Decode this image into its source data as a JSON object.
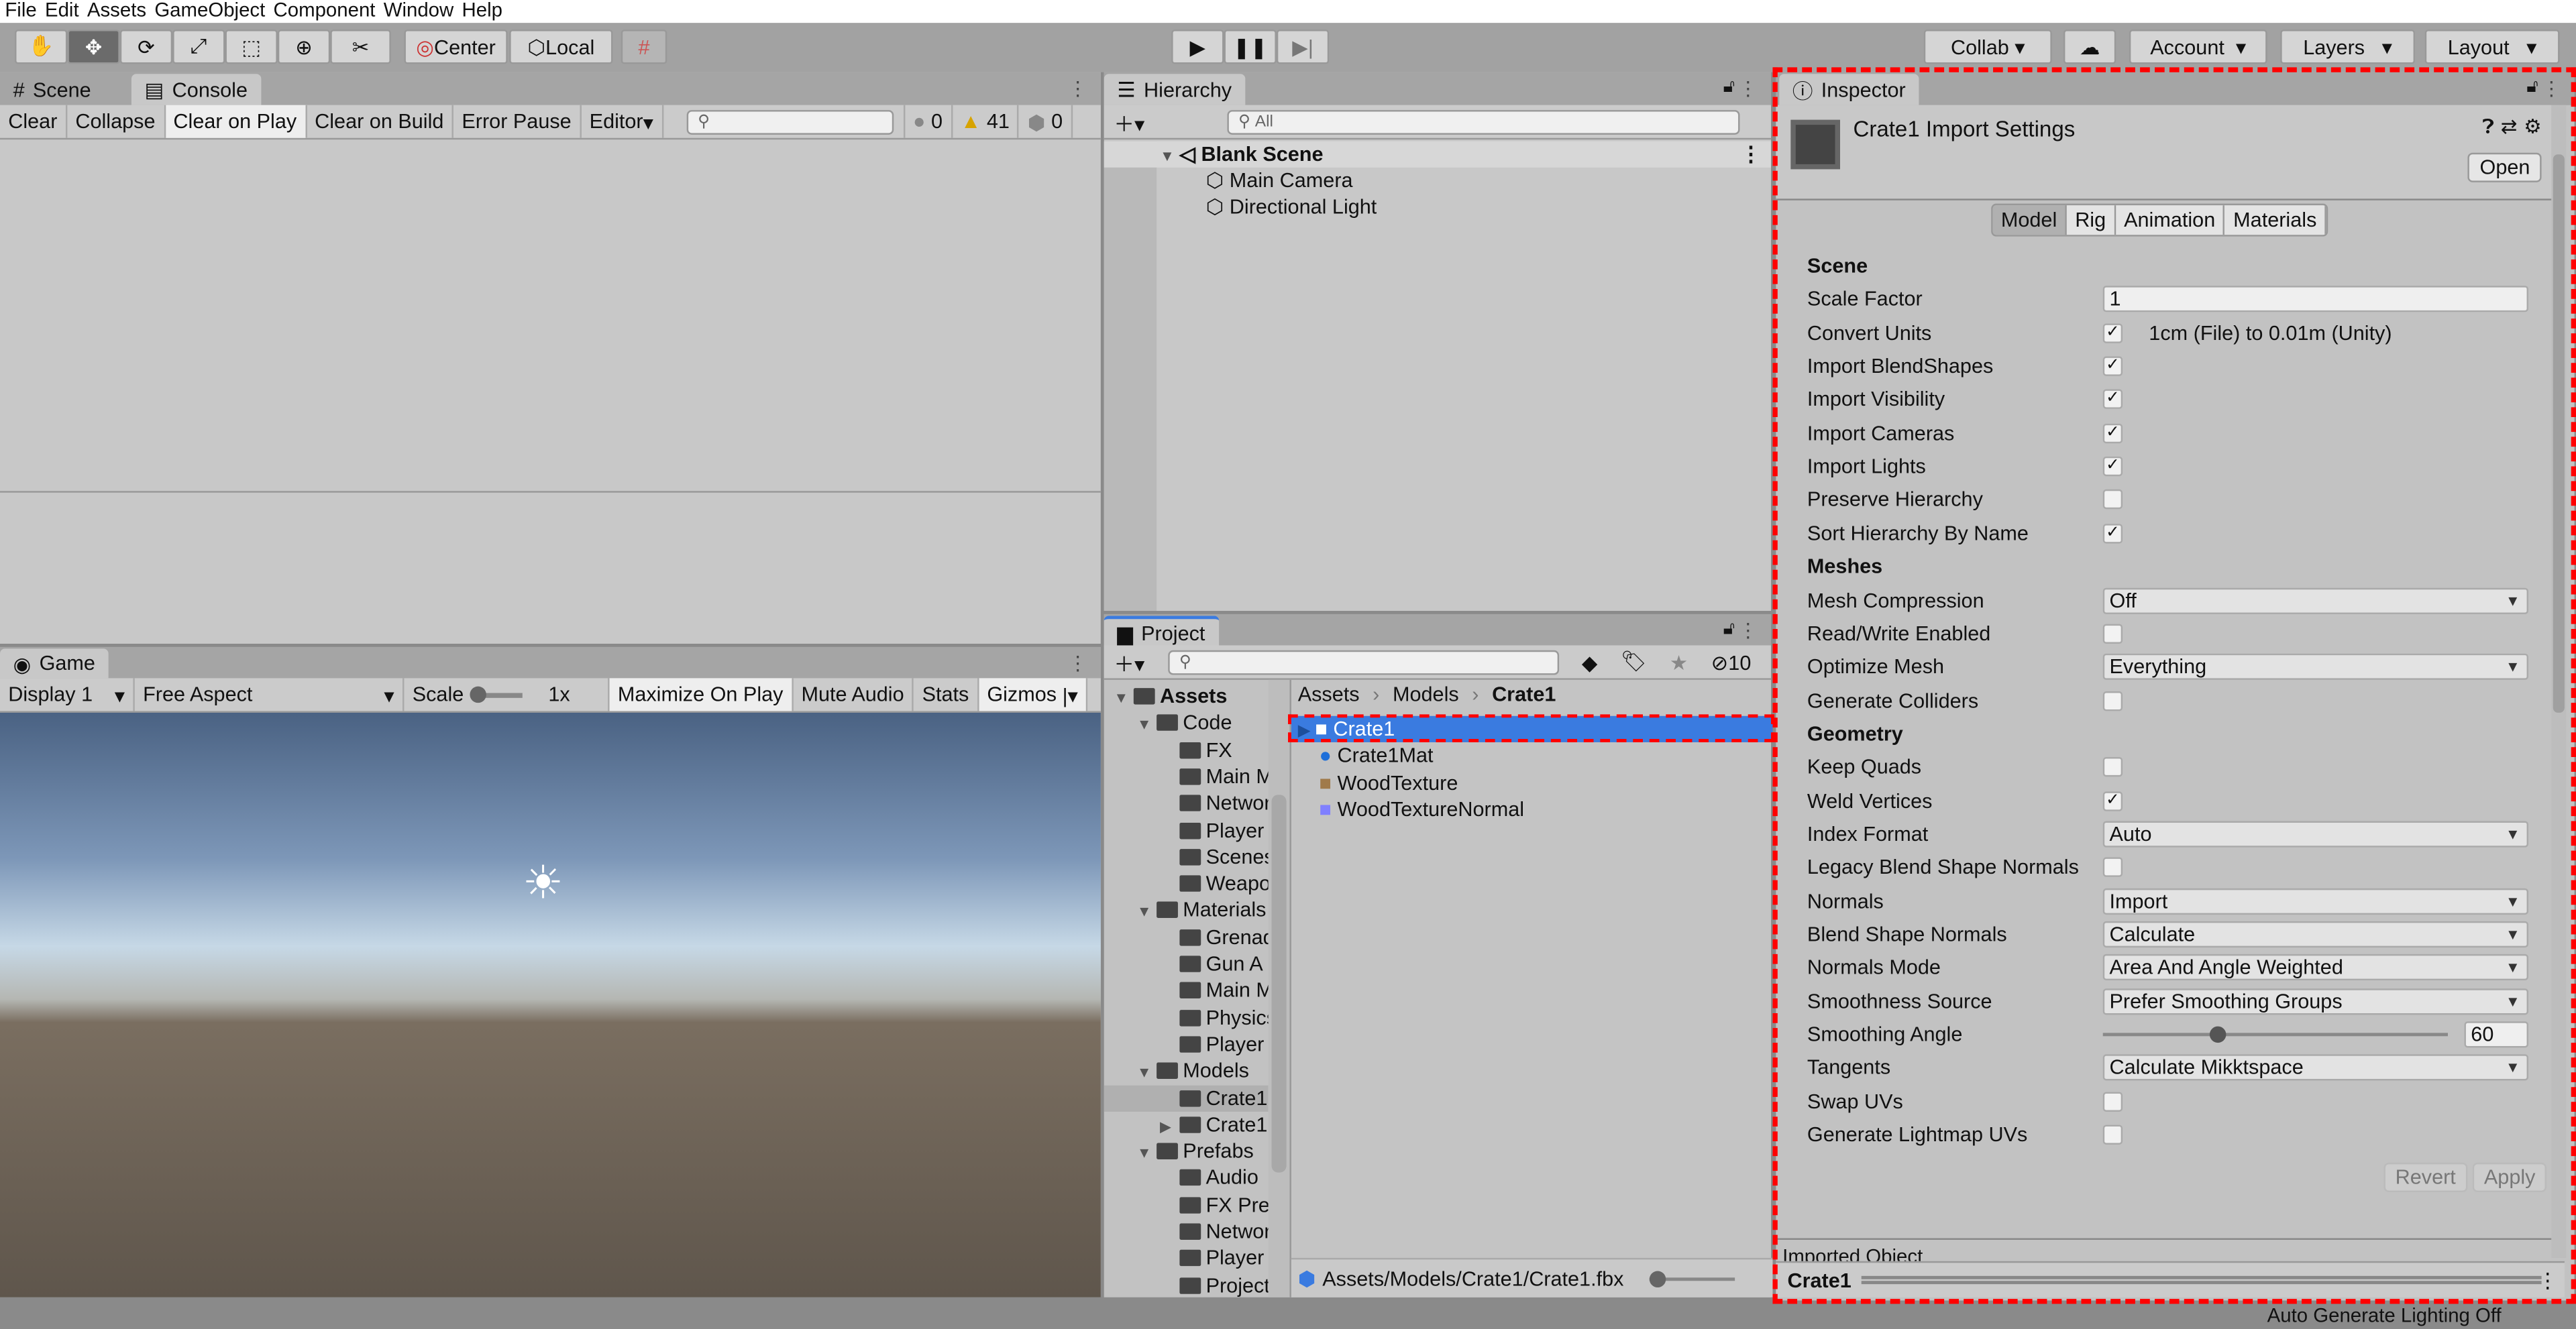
{
  "menu": [
    "File",
    "Edit",
    "Assets",
    "GameObject",
    "Component",
    "Window",
    "Help"
  ],
  "toolbar": {
    "pivot": "Center",
    "space": "Local",
    "collab": "Collab",
    "account": "Account",
    "layers": "Layers",
    "layout": "Layout"
  },
  "console": {
    "tabs": [
      "Scene",
      "Console"
    ],
    "buttons": [
      "Clear",
      "Collapse",
      "Clear on Play",
      "Clear on Build",
      "Error Pause",
      "Editor"
    ],
    "counts": {
      "errors_info": "0",
      "warnings": "41",
      "errors": "0"
    }
  },
  "game": {
    "tab": "Game",
    "display": "Display 1",
    "aspect": "Free Aspect",
    "scale_label": "Scale",
    "scale_value": "1x",
    "buttons": [
      "Maximize On Play",
      "Mute Audio",
      "Stats",
      "Gizmos"
    ]
  },
  "hierarchy": {
    "tab": "Hierarchy",
    "search_placeholder": "All",
    "scene": "Blank Scene",
    "items": [
      "Main Camera",
      "Directional Light"
    ]
  },
  "project": {
    "tab": "Project",
    "hidden_count": "10",
    "tree": [
      {
        "label": "Assets",
        "level": 0,
        "open": true,
        "bold": true
      },
      {
        "label": "Code",
        "level": 1,
        "open": true
      },
      {
        "label": "FX",
        "level": 2
      },
      {
        "label": "Main Menu",
        "level": 2
      },
      {
        "label": "Network",
        "level": 2
      },
      {
        "label": "Player",
        "level": 2
      },
      {
        "label": "Scenes",
        "level": 2
      },
      {
        "label": "Weapons",
        "level": 2
      },
      {
        "label": "Materials",
        "level": 1,
        "open": true
      },
      {
        "label": "Grenade",
        "level": 2
      },
      {
        "label": "Gun A",
        "level": 2
      },
      {
        "label": "Main Menu",
        "level": 2
      },
      {
        "label": "Physics",
        "level": 2
      },
      {
        "label": "Player",
        "level": 2
      },
      {
        "label": "Models",
        "level": 1,
        "open": true
      },
      {
        "label": "Crate1",
        "level": 2,
        "selected": true
      },
      {
        "label": "Crate1",
        "level": 2,
        "closed": true
      },
      {
        "label": "Prefabs",
        "level": 1,
        "open": true
      },
      {
        "label": "Audio",
        "level": 2
      },
      {
        "label": "FX Prefabs",
        "level": 2
      },
      {
        "label": "Network",
        "level": 2
      },
      {
        "label": "Player",
        "level": 2
      },
      {
        "label": "Projectiles",
        "level": 2
      }
    ],
    "breadcrumb": [
      "Assets",
      "Models",
      "Crate1"
    ],
    "files": [
      {
        "name": "Crate1",
        "icon": "model-icon",
        "selected": true
      },
      {
        "name": "Crate1Mat",
        "icon": "material-icon"
      },
      {
        "name": "WoodTexture",
        "icon": "texture-icon"
      },
      {
        "name": "WoodTextureNormal",
        "icon": "normal-map-icon"
      }
    ],
    "path": "Assets/Models/Crate1/Crate1.fbx"
  },
  "inspector": {
    "tab": "Inspector",
    "title": "Crate1 Import Settings",
    "open": "Open",
    "tabs": [
      "Model",
      "Rig",
      "Animation",
      "Materials"
    ],
    "active_tab": "Model",
    "rows": [
      {
        "type": "header",
        "label": "Scene"
      },
      {
        "type": "field",
        "label": "Scale Factor",
        "value": "1"
      },
      {
        "type": "check",
        "label": "Convert Units",
        "checked": true,
        "note": "1cm (File) to 0.01m (Unity)"
      },
      {
        "type": "check",
        "label": "Import BlendShapes",
        "checked": true
      },
      {
        "type": "check",
        "label": "Import Visibility",
        "checked": true
      },
      {
        "type": "check",
        "label": "Import Cameras",
        "checked": true
      },
      {
        "type": "check",
        "label": "Import Lights",
        "checked": true
      },
      {
        "type": "check",
        "label": "Preserve Hierarchy",
        "checked": false
      },
      {
        "type": "check",
        "label": "Sort Hierarchy By Name",
        "checked": true
      },
      {
        "type": "header",
        "label": "Meshes"
      },
      {
        "type": "dropdown",
        "label": "Mesh Compression",
        "value": "Off"
      },
      {
        "type": "check",
        "label": "Read/Write Enabled",
        "checked": false
      },
      {
        "type": "dropdown",
        "label": "Optimize Mesh",
        "value": "Everything"
      },
      {
        "type": "check",
        "label": "Generate Colliders",
        "checked": false
      },
      {
        "type": "header",
        "label": "Geometry"
      },
      {
        "type": "check",
        "label": "Keep Quads",
        "checked": false
      },
      {
        "type": "check",
        "label": "Weld Vertices",
        "checked": true
      },
      {
        "type": "dropdown",
        "label": "Index Format",
        "value": "Auto"
      },
      {
        "type": "check",
        "label": "Legacy Blend Shape Normals",
        "checked": false
      },
      {
        "type": "dropdown",
        "label": "Normals",
        "value": "Import"
      },
      {
        "type": "dropdown",
        "label": "Blend Shape Normals",
        "value": "Calculate"
      },
      {
        "type": "dropdown",
        "label": "Normals Mode",
        "value": "Area And Angle Weighted"
      },
      {
        "type": "dropdown",
        "label": "Smoothness Source",
        "value": "Prefer Smoothing Groups"
      },
      {
        "type": "slider",
        "label": "Smoothing Angle",
        "value": "60",
        "min": 0,
        "max": 180
      },
      {
        "type": "dropdown",
        "label": "Tangents",
        "value": "Calculate Mikktspace"
      },
      {
        "type": "check",
        "label": "Swap UVs",
        "checked": false
      },
      {
        "type": "check",
        "label": "Generate Lightmap UVs",
        "checked": false
      }
    ],
    "revert": "Revert",
    "apply": "Apply",
    "imported_object": "Imported Object",
    "preview_name": "Crate1"
  },
  "status": "Auto Generate Lighting Off",
  "colors": {
    "selection": "#3a7be0",
    "highlight": "#ff0000"
  }
}
